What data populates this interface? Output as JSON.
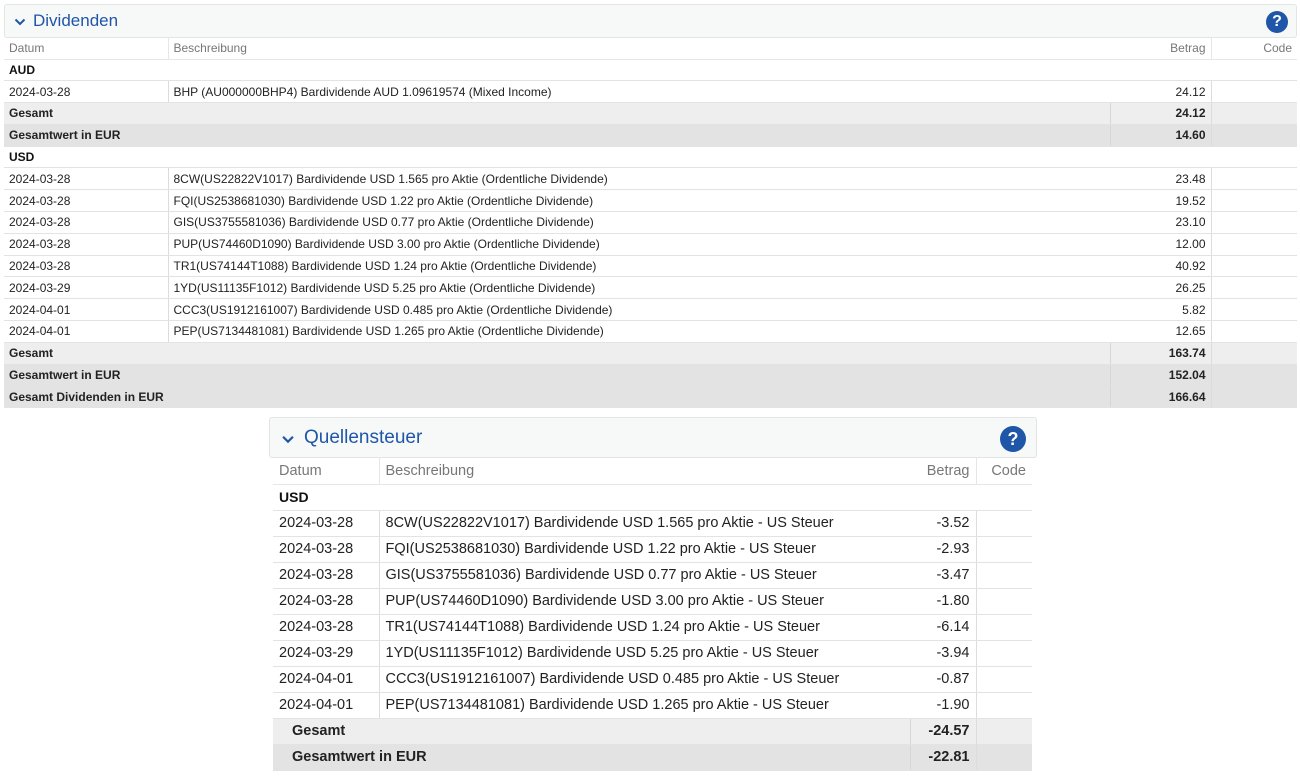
{
  "dividends": {
    "title": "Dividenden",
    "help_label": "?",
    "columns": {
      "date": "Datum",
      "description": "Beschreibung",
      "amount": "Betrag",
      "code": "Code"
    },
    "groups": [
      {
        "currency": "AUD",
        "rows": [
          {
            "date": "2024-03-28",
            "description": "BHP (AU000000BHP4) Bardividende AUD 1.09619574 (Mixed Income)",
            "amount": "24.12",
            "code": ""
          }
        ],
        "totals": [
          {
            "label": "Gesamt",
            "amount": "24.12"
          },
          {
            "label": "Gesamtwert in EUR",
            "amount": "14.60"
          }
        ]
      },
      {
        "currency": "USD",
        "rows": [
          {
            "date": "2024-03-28",
            "description": "8CW(US22822V1017) Bardividende USD 1.565 pro Aktie (Ordentliche Dividende)",
            "amount": "23.48",
            "code": ""
          },
          {
            "date": "2024-03-28",
            "description": "FQI(US2538681030) Bardividende USD 1.22 pro Aktie (Ordentliche Dividende)",
            "amount": "19.52",
            "code": ""
          },
          {
            "date": "2024-03-28",
            "description": "GIS(US3755581036) Bardividende USD 0.77 pro Aktie (Ordentliche Dividende)",
            "amount": "23.10",
            "code": ""
          },
          {
            "date": "2024-03-28",
            "description": "PUP(US74460D1090) Bardividende USD 3.00 pro Aktie (Ordentliche Dividende)",
            "amount": "12.00",
            "code": ""
          },
          {
            "date": "2024-03-28",
            "description": "TR1(US74144T1088) Bardividende USD 1.24 pro Aktie (Ordentliche Dividende)",
            "amount": "40.92",
            "code": ""
          },
          {
            "date": "2024-03-29",
            "description": "1YD(US11135F1012) Bardividende USD 5.25 pro Aktie (Ordentliche Dividende)",
            "amount": "26.25",
            "code": ""
          },
          {
            "date": "2024-04-01",
            "description": "CCC3(US1912161007) Bardividende USD 0.485 pro Aktie (Ordentliche Dividende)",
            "amount": "5.82",
            "code": ""
          },
          {
            "date": "2024-04-01",
            "description": "PEP(US7134481081) Bardividende USD 1.265 pro Aktie (Ordentliche Dividende)",
            "amount": "12.65",
            "code": ""
          }
        ],
        "totals": [
          {
            "label": "Gesamt",
            "amount": "163.74"
          },
          {
            "label": "Gesamtwert in EUR",
            "amount": "152.04"
          }
        ]
      }
    ],
    "grand_total": {
      "label": "Gesamt Dividenden in EUR",
      "amount": "166.64"
    }
  },
  "withholding": {
    "title": "Quellensteuer",
    "help_label": "?",
    "columns": {
      "date": "Datum",
      "description": "Beschreibung",
      "amount": "Betrag",
      "code": "Code"
    },
    "groups": [
      {
        "currency": "USD",
        "rows": [
          {
            "date": "2024-03-28",
            "description": "8CW(US22822V1017) Bardividende USD 1.565 pro Aktie - US Steuer",
            "amount": "-3.52",
            "code": ""
          },
          {
            "date": "2024-03-28",
            "description": "FQI(US2538681030) Bardividende USD 1.22 pro Aktie - US Steuer",
            "amount": "-2.93",
            "code": ""
          },
          {
            "date": "2024-03-28",
            "description": "GIS(US3755581036) Bardividende USD 0.77 pro Aktie - US Steuer",
            "amount": "-3.47",
            "code": ""
          },
          {
            "date": "2024-03-28",
            "description": "PUP(US74460D1090) Bardividende USD 3.00 pro Aktie - US Steuer",
            "amount": "-1.80",
            "code": ""
          },
          {
            "date": "2024-03-28",
            "description": "TR1(US74144T1088) Bardividende USD 1.24 pro Aktie - US Steuer",
            "amount": "-6.14",
            "code": ""
          },
          {
            "date": "2024-03-29",
            "description": "1YD(US11135F1012) Bardividende USD 5.25 pro Aktie - US Steuer",
            "amount": "-3.94",
            "code": ""
          },
          {
            "date": "2024-04-01",
            "description": "CCC3(US1912161007) Bardividende USD 0.485 pro Aktie - US Steuer",
            "amount": "-0.87",
            "code": ""
          },
          {
            "date": "2024-04-01",
            "description": "PEP(US7134481081) Bardividende USD 1.265 pro Aktie - US Steuer",
            "amount": "-1.90",
            "code": ""
          }
        ],
        "totals": [
          {
            "label": "Gesamt",
            "amount": "-24.57"
          },
          {
            "label": "Gesamtwert in EUR",
            "amount": "-22.81"
          }
        ]
      }
    ]
  },
  "icons": {
    "collapse": "chevron-down-icon",
    "help": "help-icon"
  },
  "colors": {
    "accent": "#1f56a8",
    "subtotal_bg": "#eeeeee",
    "total_bg": "#e3e3e3"
  }
}
